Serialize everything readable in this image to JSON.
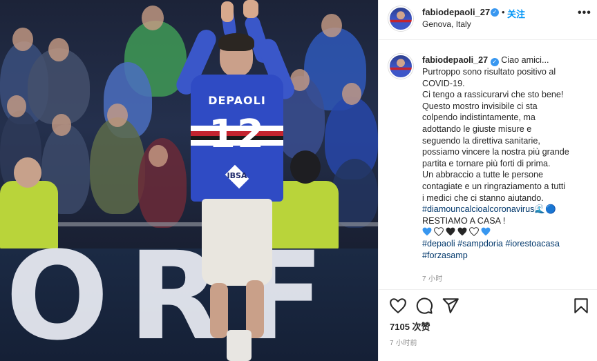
{
  "post": {
    "image": {
      "jersey_name": "DEPAOLI",
      "jersey_number": "12",
      "sponsor": "IBSA",
      "board_text": "ORF T R"
    },
    "header": {
      "username": "fabiodepaoli_27",
      "verified_icon": "verified-badge-icon",
      "separator": "•",
      "follow_label": "关注",
      "location": "Genova, Italy",
      "more_icon": "more-options-icon",
      "more_label": "•••"
    },
    "caption": {
      "username": "fabiodepaoli_27",
      "lines": [
        "Ciao amici...",
        "Purtroppo sono risultato positivo al",
        "COVID-19.",
        "Ci tengo a rassicurarvi che sto bene!",
        "Questo mostro invisibile ci sta",
        "colpendo indistintamente, ma",
        "adottando le giuste misure e",
        "seguendo la direttiva sanitarie,",
        "possiamo vincere la nostra più grande",
        "partita e tornare più forti di prima.",
        "Un abbraccio a tutte le persone",
        "contagiate e un ringraziamento a tutti",
        "i medici che ci stanno aiutando."
      ],
      "hashtag_1": "#diamouncalcioalcoronavirus",
      "emoji_after_hashtag": "🌊🔵",
      "stay_home": "RESTIAMO A CASA !",
      "hearts": [
        "blue",
        "white",
        "black",
        "black",
        "white",
        "blue"
      ],
      "hashtags_2": [
        "#depaoli",
        "#sampdoria",
        "#iorestoacasa"
      ],
      "hashtag_3": "#forzasamp",
      "time_ago": "7 小时"
    },
    "actions": {
      "like_icon": "heart-icon",
      "comment_icon": "comment-icon",
      "share_icon": "share-icon",
      "save_icon": "bookmark-icon"
    },
    "likes": "7105 次赞",
    "posted": "7 小时前",
    "colors": {
      "link": "#00376b",
      "follow": "#0095f6",
      "verified": "#3897f0",
      "jersey_blue": "#2f4bc4",
      "steward_vest": "#b9d43a",
      "heart_blue": "#3897f0"
    }
  }
}
